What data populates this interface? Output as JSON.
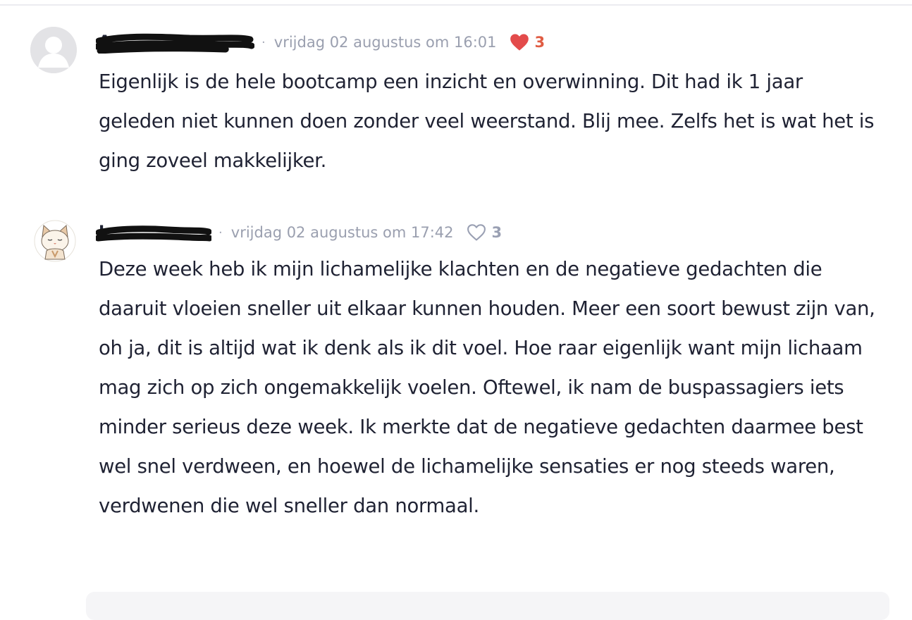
{
  "comments": [
    {
      "author": "A",
      "timestamp": "vrijdag 02 augustus om 16:01",
      "likes": "3",
      "liked": true,
      "avatar": "default-avatar-icon",
      "text": "Eigenlijk is de hele bootcamp een inzicht en overwinning. Dit had ik 1 jaar geleden niet kunnen doen zonder veel weerstand. Blij mee. Zelfs het is wat het is ging zoveel makkelijker."
    },
    {
      "author": "L",
      "timestamp": "vrijdag 02 augustus om 17:42",
      "likes": "3",
      "liked": false,
      "avatar": "cat-avatar-icon",
      "text": "Deze week heb ik mijn lichamelijke klachten en de negatieve gedachten die daaruit vloeien sneller uit elkaar kunnen houden. Meer een soort bewust zijn van, oh ja, dit is altijd wat ik denk als ik dit voel. Hoe raar eigenlijk want mijn lichaam mag zich op zich ongemakkelijk voelen. Oftewel, ik nam de buspassagiers iets minder serieus deze week. Ik merkte dat de negatieve gedachten daarmee best wel snel verdween, en hoewel de lichamelijke sensaties er nog steeds waren, verdwenen die wel sneller dan normaal."
    }
  ],
  "colors": {
    "liked_heart": "#e34b4b",
    "liked_count": "#e05c43",
    "unliked": "#9aa0b3",
    "timestamp": "#9a9faf",
    "text": "#1f2233"
  },
  "icons": {
    "separator": "·",
    "like_filled": "heart-filled-icon",
    "like_outline": "heart-outline-icon"
  }
}
